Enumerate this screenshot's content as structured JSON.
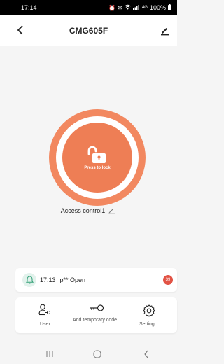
{
  "status_bar": {
    "time": "17:14",
    "signal_text": "4G",
    "battery": "100%"
  },
  "header": {
    "title": "CMG605F"
  },
  "lock": {
    "label": "Press to lock"
  },
  "device": {
    "name": "Access control1"
  },
  "notification": {
    "time": "17:13",
    "text": "p** Open",
    "badge": "39"
  },
  "actions": [
    {
      "label": "User",
      "icon": "user-key-icon"
    },
    {
      "label": "Add temporary code",
      "icon": "key-icon"
    },
    {
      "label": "Setting",
      "icon": "gear-icon"
    }
  ],
  "nav": {
    "icons": [
      "recents-icon",
      "home-icon",
      "back-icon"
    ]
  },
  "colors": {
    "accent": "#ee7e55",
    "accent_light": "#f28860",
    "badge": "#e25345",
    "bell_bg": "#e2f2ec"
  }
}
